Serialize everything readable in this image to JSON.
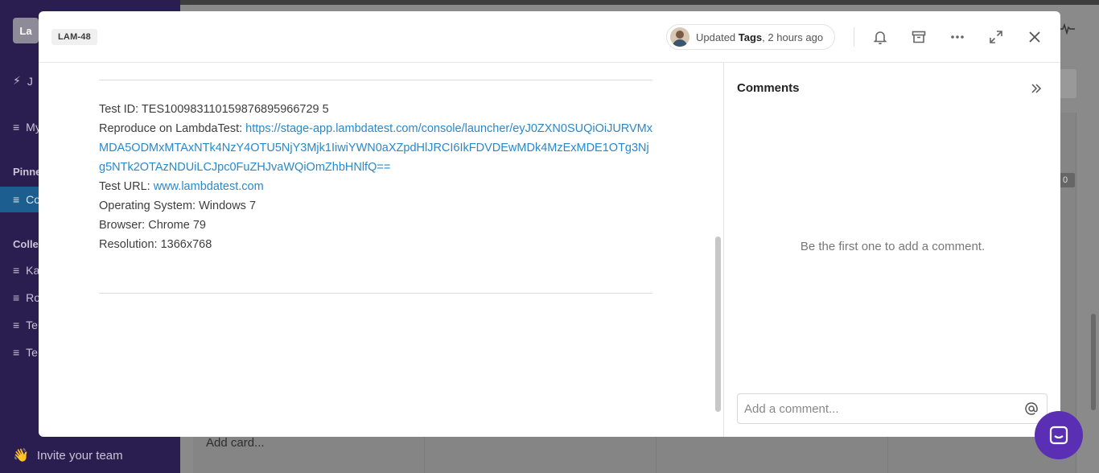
{
  "background": {
    "logo_text": "La",
    "nav": [
      {
        "label": "J",
        "icon": "lightning-icon"
      },
      {
        "label": "My",
        "icon": "list-icon"
      }
    ],
    "pinned_section": "Pinne",
    "pinned_item": "Co",
    "collections_section": "Colle",
    "collections": [
      "Ka",
      "Ro",
      "Te",
      "Te"
    ],
    "invite_label": "Invite your team",
    "add_card_label": "Add card...",
    "right_badge": "0"
  },
  "modal": {
    "ticket_id": "LAM-48",
    "updated": {
      "prefix": "Updated",
      "field": "Tags",
      "suffix": ", 2 hours ago"
    },
    "details": {
      "test_id": "Test ID: TES100983110159876895966729 5",
      "reproduce_label": "Reproduce on LambdaTest: ",
      "reproduce_url": "https://stage-app.lambdatest.com/console/launcher/eyJ0ZXN0SUQiOiJURVMxMDA5ODMxMTAxNTk4NzY4OTU5NjY3Mjk1IiwiYWN0aXZpdHlJRCI6IkFDVDEwMDk4MzExMDE1OTg3Njg5NTk2OTAzNDUiLCJpc0FuZHJvaWQiOmZhbHNlfQ==",
      "test_url_label": "Test URL: ",
      "test_url": "www.lambdatest.com",
      "os": "Operating System: Windows 7",
      "browser": "Browser: Chrome 79",
      "resolution": "Resolution: 1366x768"
    },
    "comments": {
      "title": "Comments",
      "empty_message": "Be the first one to add a comment.",
      "input_placeholder": "Add a comment..."
    }
  },
  "colors": {
    "link": "#2b88c8",
    "sidebar": "#2a1d4f",
    "chat_bubble": "#5b2fb4"
  }
}
